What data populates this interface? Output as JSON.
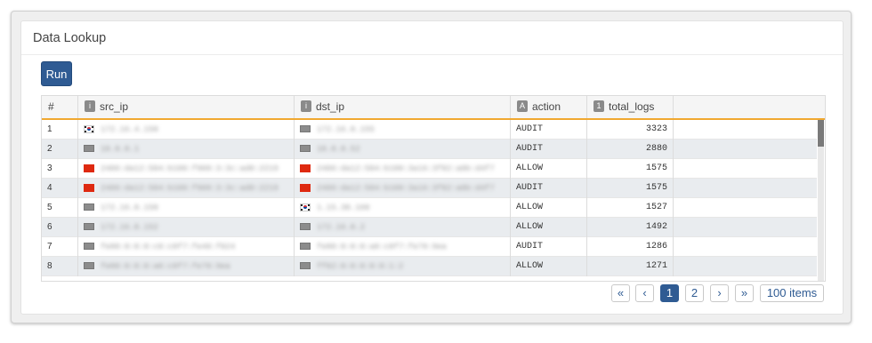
{
  "panel": {
    "title": "Data Lookup"
  },
  "toolbar": {
    "run_label": "Run"
  },
  "grid": {
    "columns": [
      {
        "label": "#",
        "type_badge": ""
      },
      {
        "label": "src_ip",
        "type_badge": "i"
      },
      {
        "label": "dst_ip",
        "type_badge": "i"
      },
      {
        "label": "action",
        "type_badge": "A"
      },
      {
        "label": "total_logs",
        "type_badge": "1"
      }
    ],
    "rows": [
      {
        "num": "1",
        "src_flag": "kr",
        "src_ip": "172.16.4.150",
        "dst_flag": "monitor",
        "dst_ip": "172.16.0.155",
        "action": "AUDIT",
        "total_logs": "3323"
      },
      {
        "num": "2",
        "src_flag": "monitor",
        "src_ip": "10.0.0.1",
        "dst_flag": "monitor",
        "dst_ip": "10.0.0.52",
        "action": "AUDIT",
        "total_logs": "2880"
      },
      {
        "num": "3",
        "src_flag": "cn",
        "src_ip": "2406:da12:504:b100:f908:3:3c:ad0:2219",
        "dst_flag": "cn",
        "dst_ip": "2406:da12:504:b100:3a16:3f82:a0b:d4f7",
        "action": "ALLOW",
        "total_logs": "1575"
      },
      {
        "num": "4",
        "src_flag": "cn",
        "src_ip": "2406:da12:504:b100:f908:3:3c:ad0:2219",
        "dst_flag": "cn",
        "dst_ip": "2406:da12:504:b100:3a16:3f82:a0b:d4f7",
        "action": "AUDIT",
        "total_logs": "1575"
      },
      {
        "num": "5",
        "src_flag": "monitor",
        "src_ip": "172.16.0.150",
        "dst_flag": "kr",
        "dst_ip": "1.15.30.160",
        "action": "ALLOW",
        "total_logs": "1527"
      },
      {
        "num": "6",
        "src_flag": "monitor",
        "src_ip": "172.16.0.152",
        "dst_flag": "monitor",
        "dst_ip": "172.16.0.2",
        "action": "ALLOW",
        "total_logs": "1492"
      },
      {
        "num": "7",
        "src_flag": "monitor",
        "src_ip": "fe80:0:0:0:c0:c0f7:fe40:f024",
        "dst_flag": "monitor",
        "dst_ip": "fe80:0:0:0:a0:c0f7:fe78:9ea",
        "action": "AUDIT",
        "total_logs": "1286"
      },
      {
        "num": "8",
        "src_flag": "monitor",
        "src_ip": "fe80:0:0:0:a0:c0f7:fe78:9ea",
        "dst_flag": "monitor",
        "dst_ip": "ff02:0:0:0:0:0:1:2",
        "action": "ALLOW",
        "total_logs": "1271"
      }
    ]
  },
  "pagination": {
    "first_icon": "«",
    "prev_icon": "‹",
    "pages": [
      "1",
      "2"
    ],
    "current_page": "1",
    "next_icon": "›",
    "last_icon": "»",
    "items_label": "100 items"
  },
  "colors": {
    "accent": "#2f5b93",
    "header_underline": "#f0a830",
    "row_alt": "#e9ecef"
  }
}
